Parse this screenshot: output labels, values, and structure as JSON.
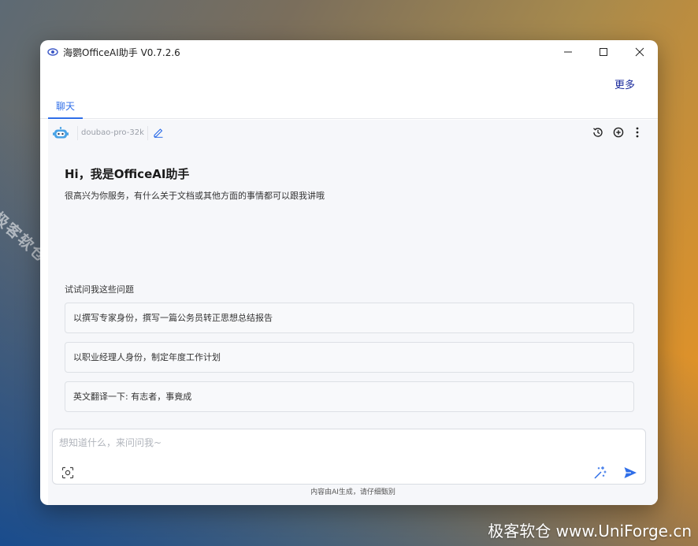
{
  "window": {
    "title": "海鹦OfficeAI助手 V0.7.2.6",
    "more_label": "更多"
  },
  "tabs": [
    {
      "label": "聊天"
    }
  ],
  "toolbar": {
    "model_name": "doubao-pro-32k"
  },
  "greeting": {
    "title": "Hi，我是OfficeAI助手",
    "subtitle": "很高兴为你服务，有什么关于文档或其他方面的事情都可以跟我讲哦"
  },
  "suggestions": {
    "title": "试试问我这些问题",
    "items": [
      {
        "label": "以撰写专家身份，撰写一篇公务员转正思想总结报告"
      },
      {
        "label": "以职业经理人身份，制定年度工作计划"
      },
      {
        "label": "英文翻译一下: 有志者，事竟成"
      }
    ]
  },
  "input": {
    "placeholder": "想知道什么，来问问我~",
    "value": ""
  },
  "disclaimer": "内容由AI生成，请仔细甄别",
  "watermarks": {
    "diagonal": "极客软仓 UniForge.cn",
    "corner": "极客软仓 www.UniForge.cn"
  },
  "icons": {
    "app": "eye-logo-icon",
    "bot": "robot-icon",
    "edit": "pencil-icon",
    "history": "history-icon",
    "new_chat": "plus-circle-icon",
    "menu": "vertical-dots-icon",
    "screenshot": "screenshot-icon",
    "magic": "sparkle-icon",
    "send": "send-icon"
  },
  "colors": {
    "accent": "#2f6ee8",
    "link": "#1a2a9c",
    "panel": "#f6f7fa",
    "border": "#dde0e5"
  }
}
